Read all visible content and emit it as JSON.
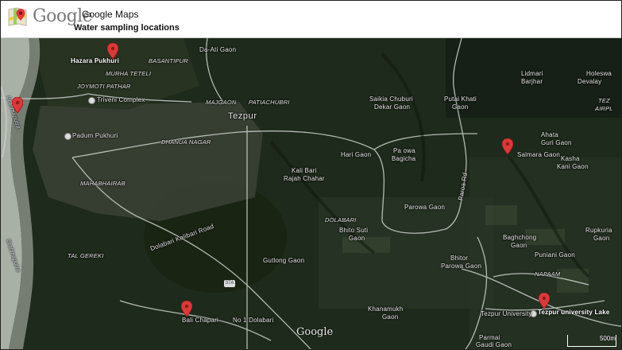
{
  "header": {
    "logo_word": "Google",
    "app_name": "Google Maps",
    "title": "Water sampling locations"
  },
  "map": {
    "type": "satellite",
    "watermark": "Google",
    "scale_label": "500m",
    "road_shield": "37A",
    "labels": {
      "hazara_pukhuri": "Hazara Pukhuri",
      "basantipur": "BASANTIPUR",
      "da_ati_gaon": "Da-Ati Gaon",
      "murha_teteli": "MURHA TETELI",
      "joymoti_pathar": "JOYMOTI PATHAR",
      "triveni_complex": "Triveni Complex",
      "majgaon": "MAJGAON",
      "patiachubri": "PATIACHUBRI",
      "tezpur": "Tezpur",
      "padum_pukhuri": "Padum Pukhuri",
      "dhanua_nagar": "DHANUA NAGAR",
      "mahabhairab": "MAHABHAIRAB",
      "saikia_chuburi_1": "Saikia Chuburi",
      "saikia_chuburi_2": "Dekar Gaon",
      "putai_khati_1": "Putai Khati",
      "putai_khati_2": "Gaon",
      "lidmari_1": "Lidmari",
      "lidmari_2": "Barjhar",
      "holeswa_1": "Holeswa",
      "holeswa_2": "Devalay",
      "tezpur_airport": "TEZ",
      "airport_2": "AIRPL",
      "ahata_1": "Ahata",
      "ahata_2": "Guri Gaon",
      "salmara_gaon": "Salmara Gaon",
      "kasha_1": "Kasha",
      "kasha_2": "Kani Gaon",
      "hari_gaon": "Hari Gaon",
      "pa_owa_1": "Pa owa",
      "pa_owa_2": "Bagicha",
      "kali_bari_1": "Kali Bari",
      "kali_bari_2": "Rajah Chahar",
      "dolabari": "DOLABARI",
      "parowa_gaon": "Parowa Gaon",
      "bhito_suti_1": "Bhito Suti",
      "bhito_suti_2": "Gaon",
      "baghchong_1": "Baghchong",
      "baghchong_2": "Gaon",
      "rupkuria_1": "Rupkuria",
      "rupkuria_2": "Gaon",
      "puniani_gaon": "Puniani Gaon",
      "tal_gereki": "TAL GEREKI",
      "gutlong_gaon": "Gutlong Gaon",
      "bhitor_parowa_1": "Bhitor",
      "bhitor_parowa_2": "Parowa Gaon",
      "napaam": "NAPAAM",
      "khanamukh_1": "Khanamukh",
      "khanamukh_2": "Gaon",
      "bali_chapari": "Bali Chapari",
      "no1_dolabari": "No 1 Dolabari",
      "tezpur_university": "Tezpur University",
      "tezpur_university_lake": "Tezpur university Lake",
      "parmai_1": "Parmai",
      "parmai_2": "Gaudi Gaon",
      "brahmaputra_1": "Brahmaputra",
      "brahmaputra_2": "Brahmaputra",
      "dolabari_road": "Dolabari Kalibari Road",
      "paroa_road": "Paroa Rd"
    }
  },
  "colors": {
    "pin": "#d93a3a",
    "pin_dark": "#8e1b1b",
    "river": "#b9bfb9",
    "road": "#cfd2cf"
  }
}
